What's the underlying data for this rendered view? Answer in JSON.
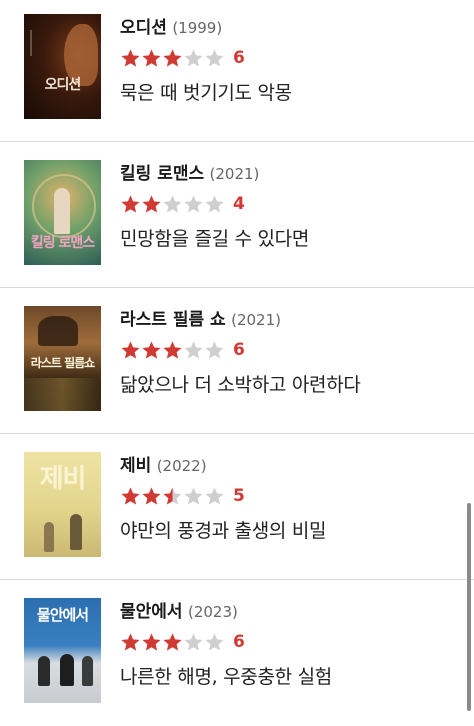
{
  "colors": {
    "star_filled": "#d03a33",
    "star_empty": "#cfcfcf",
    "score": "#d03a33"
  },
  "icons": {
    "star_full": "star-icon",
    "star_half": "half-star-icon",
    "star_empty": "empty-star-icon"
  },
  "movies": [
    {
      "title": "오디션",
      "year": "(1999)",
      "score": "6",
      "rating_out_of_5": 3,
      "comment": "묵은 때 벗기기도 악몽",
      "poster_text": "오디션"
    },
    {
      "title": "킬링 로맨스",
      "year": "(2021)",
      "score": "4",
      "rating_out_of_5": 2,
      "comment": "민망함을 즐길 수 있다면",
      "poster_text": "킬링 로맨스"
    },
    {
      "title": "라스트 필름 쇼",
      "year": "(2021)",
      "score": "6",
      "rating_out_of_5": 3,
      "comment": "닮았으나 더 소박하고 아련하다",
      "poster_text": "라스트 필름쇼"
    },
    {
      "title": "제비",
      "year": "(2022)",
      "score": "5",
      "rating_out_of_5": 2.5,
      "comment": "야만의 풍경과 출생의 비밀",
      "poster_text": "제비"
    },
    {
      "title": "물안에서",
      "year": "(2023)",
      "score": "6",
      "rating_out_of_5": 3,
      "comment": "나른한 해명, 우중충한 실험",
      "poster_text": "물안에서"
    }
  ]
}
